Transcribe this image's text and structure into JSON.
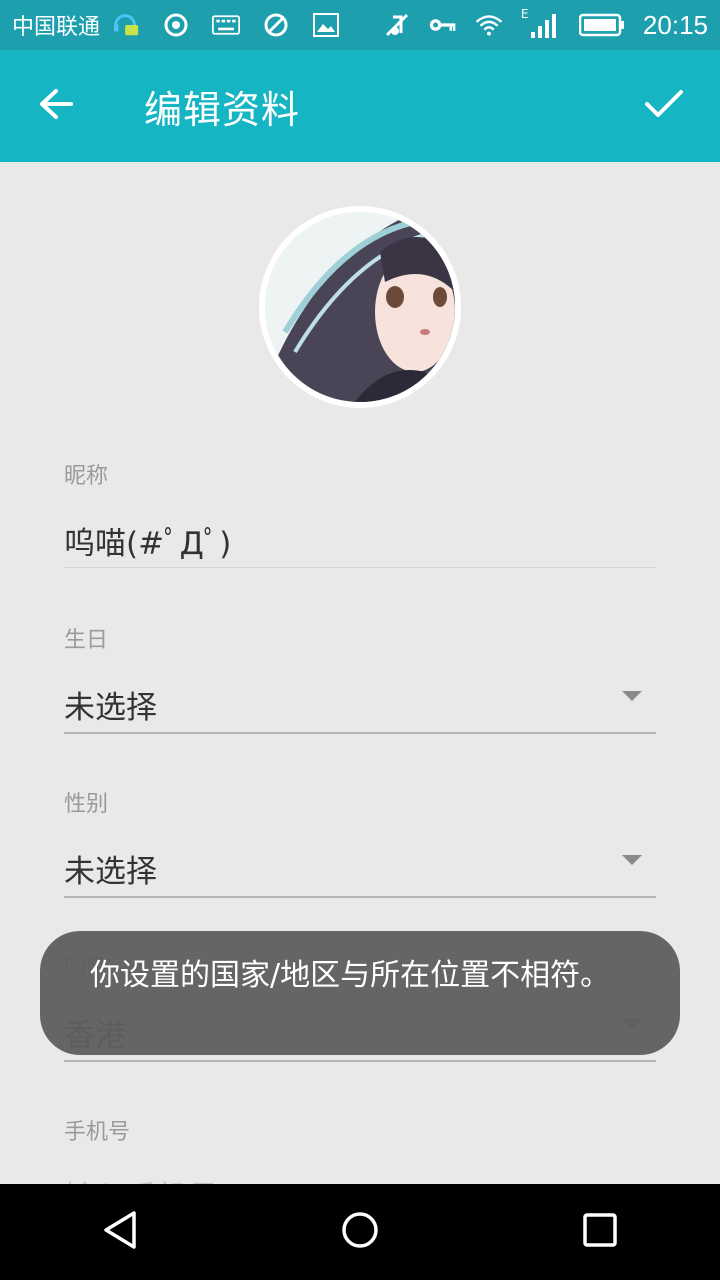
{
  "status_bar": {
    "carrier": "中国联通",
    "time": "20:15",
    "network_type": "E",
    "icons": [
      "headset-chat-icon",
      "sync-icon",
      "keyboard-icon",
      "blocked-icon",
      "image-icon",
      "mute-icon",
      "key-icon",
      "wifi-icon",
      "signal-icon",
      "battery-icon"
    ]
  },
  "app_bar": {
    "title": "编辑资料",
    "back_icon": "arrow-left-icon",
    "confirm_icon": "check-icon",
    "background": "#16b5c4"
  },
  "profile": {
    "nickname_label": "昵称",
    "nickname_value": "呜喵(#ﾟДﾟ)",
    "birthday_label": "生日",
    "birthday_value": "未选择",
    "gender_label": "性别",
    "gender_value": "未选择",
    "region_label": "国家",
    "region_value": "香港",
    "phone_label": "手机号",
    "phone_placeholder": "输入手机号"
  },
  "toast": {
    "message": "你设置的国家/地区与所在位置不相符。"
  },
  "nav_bar": {
    "back_icon": "triangle-back-icon",
    "home_icon": "circle-home-icon",
    "recents_icon": "square-recents-icon"
  }
}
